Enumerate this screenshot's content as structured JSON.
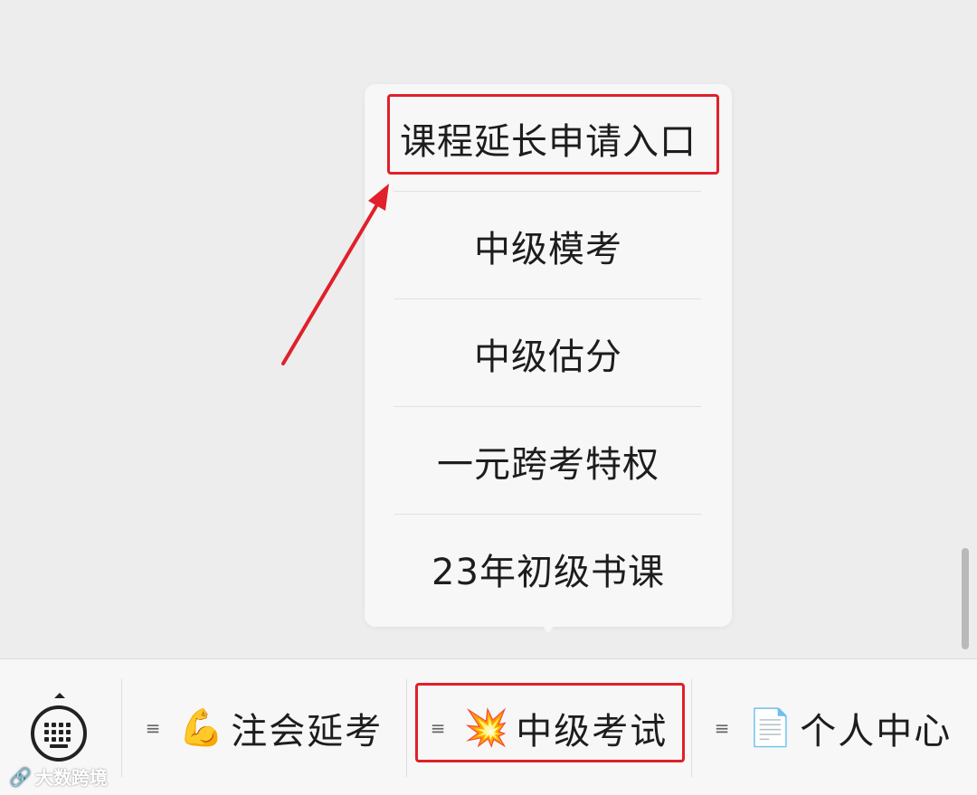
{
  "submenu": {
    "items": [
      {
        "label": "课程延长申请入口",
        "highlighted": true
      },
      {
        "label": "中级模考",
        "highlighted": false
      },
      {
        "label": "中级估分",
        "highlighted": false
      },
      {
        "label": "一元跨考特权",
        "highlighted": false
      },
      {
        "label": "23年初级书课",
        "highlighted": false
      }
    ]
  },
  "menubar": {
    "keyboard_icon": "keyboard-icon",
    "tabs": [
      {
        "icon": "muscle-emoji",
        "emoji": "💪",
        "label": "注会延考",
        "highlighted": false
      },
      {
        "icon": "collision-emoji",
        "emoji": "💥",
        "label": "中级考试",
        "highlighted": true
      },
      {
        "icon": "document-emoji",
        "emoji": "📄",
        "label": "个人中心",
        "highlighted": false
      }
    ],
    "menu_lines_glyph": "≡"
  },
  "annotations": {
    "highlight_color": "#e0202a"
  },
  "watermark": {
    "logo": "🔗",
    "text": "大数跨境"
  }
}
